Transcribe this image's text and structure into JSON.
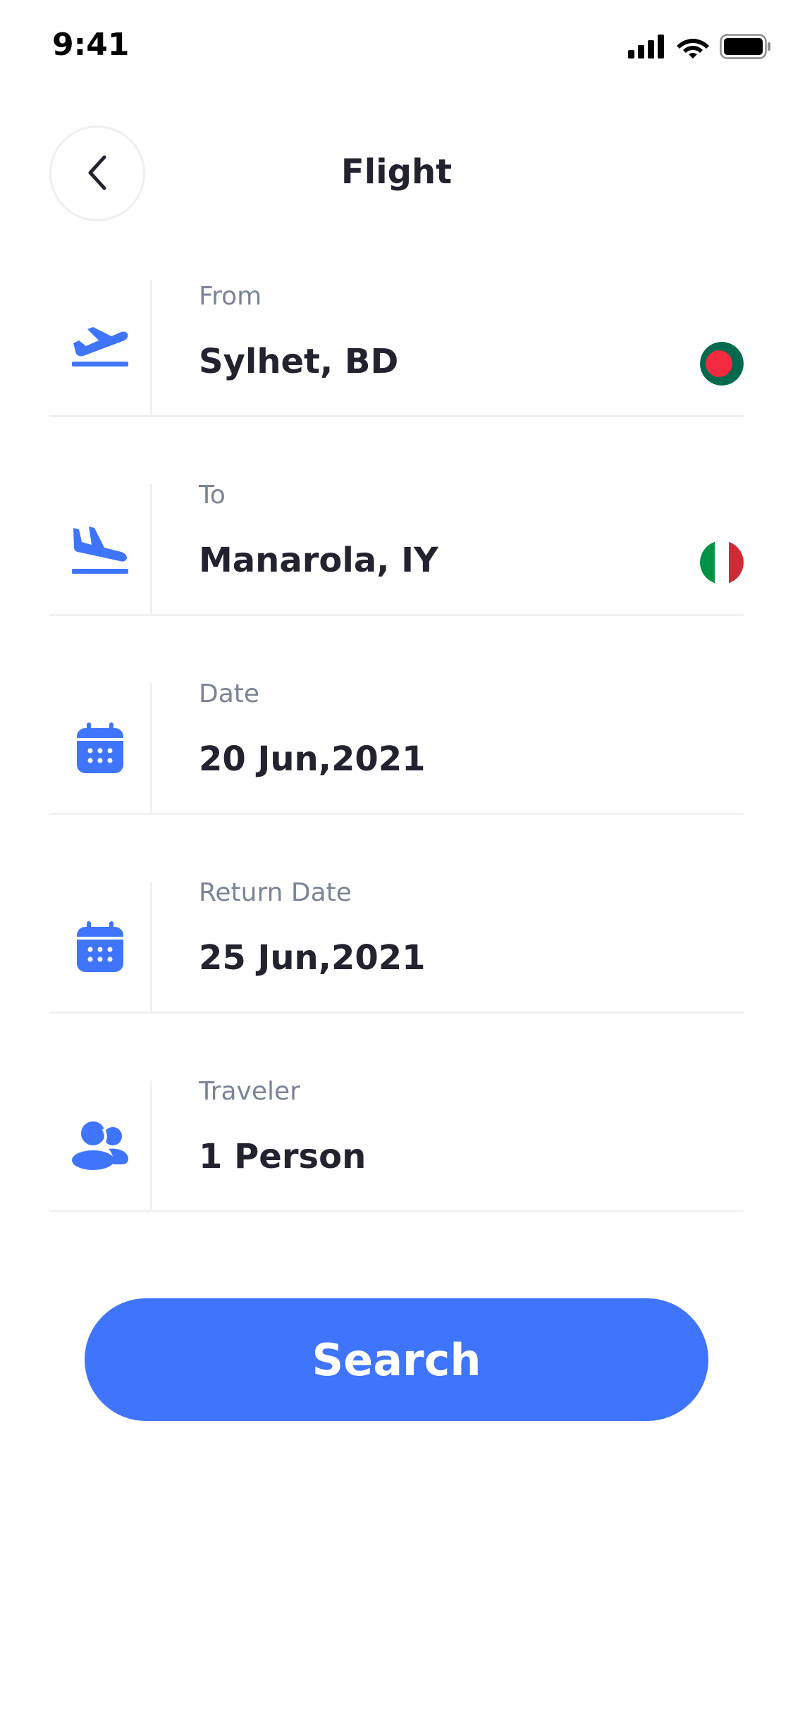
{
  "status_bar": {
    "time": "9:41",
    "icons": [
      "signal-icon",
      "wifi-icon",
      "battery-icon"
    ]
  },
  "header": {
    "title": "Flight",
    "back_icon": "chevron-left-icon"
  },
  "fields": [
    {
      "key": "from",
      "label": "From",
      "value": "Sylhet, BD",
      "icon": "takeoff-icon",
      "flag": "bangladesh-flag"
    },
    {
      "key": "to",
      "label": "To",
      "value": "Manarola, IY",
      "icon": "landing-icon",
      "flag": "italy-flag"
    },
    {
      "key": "date",
      "label": "Date",
      "value": "20 Jun,2021",
      "icon": "calendar-icon"
    },
    {
      "key": "return_date",
      "label": "Return Date",
      "value": "25 Jun,2021",
      "icon": "calendar-icon"
    },
    {
      "key": "traveler",
      "label": "Traveler",
      "value": "1 Person",
      "icon": "people-icon"
    }
  ],
  "search_button": {
    "label": "Search"
  },
  "colors": {
    "accent": "#3F74FC",
    "text_primary": "#22232F",
    "text_secondary": "#7B8396",
    "divider": "#F0F0F4",
    "bd_green": "#006A4E",
    "bd_red": "#F42A41",
    "it_green": "#009246",
    "it_white": "#FFFFFF",
    "it_red": "#CE2B37"
  }
}
